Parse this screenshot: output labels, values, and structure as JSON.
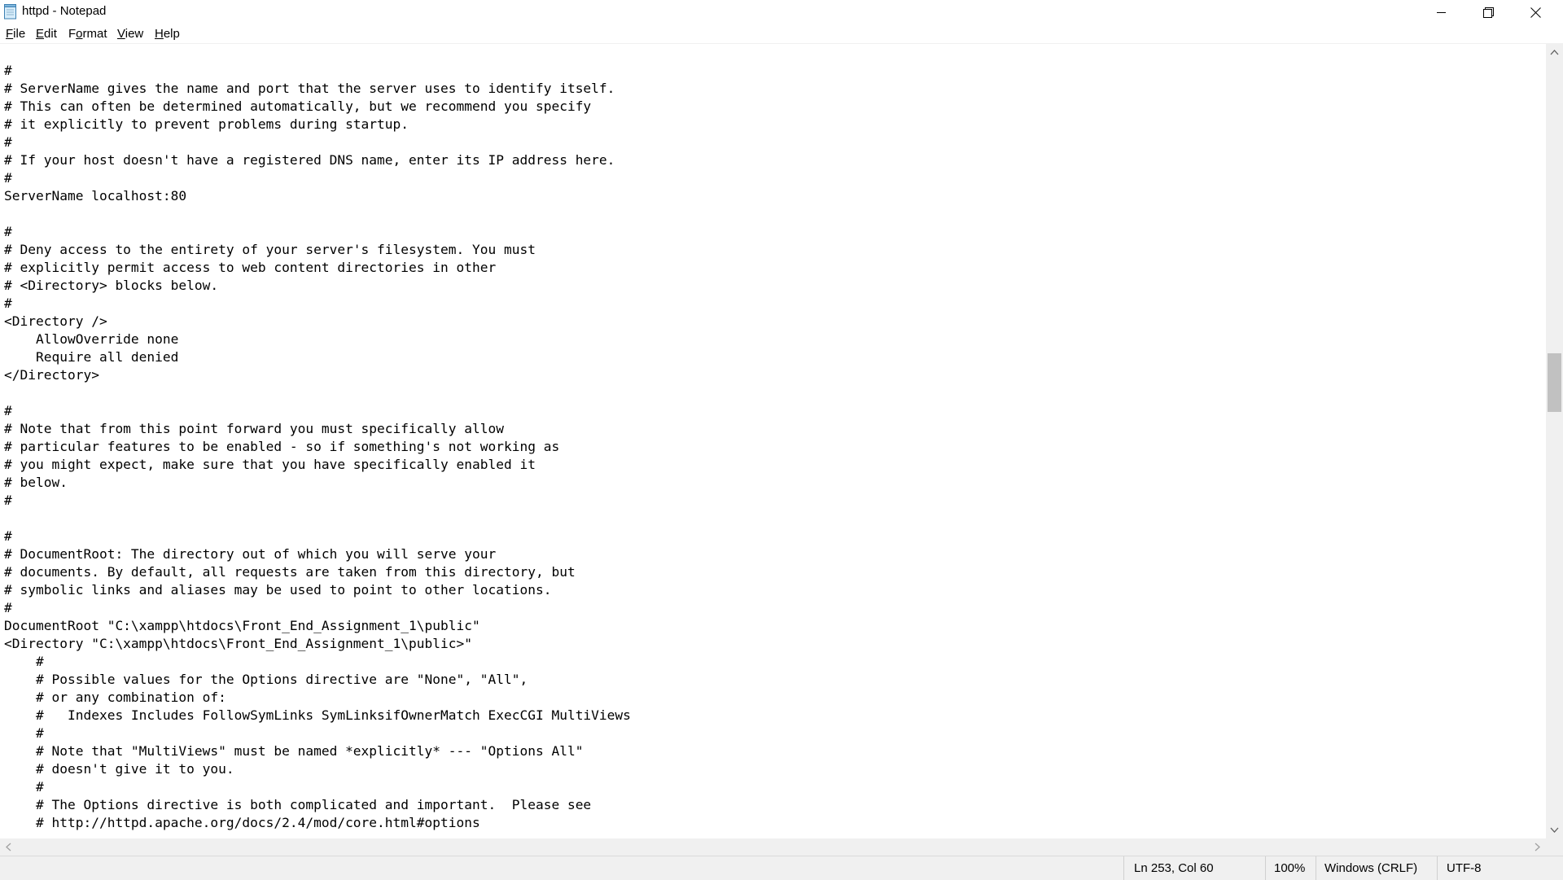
{
  "window": {
    "title": "httpd - Notepad",
    "controls": [
      "minimize",
      "restore",
      "close"
    ]
  },
  "menu": {
    "items": [
      {
        "label": "File",
        "mnemonic": "F",
        "rest": "ile"
      },
      {
        "label": "Edit",
        "mnemonic": "E",
        "rest": "dit"
      },
      {
        "label": "Format",
        "mnemonic": "o",
        "pre": "F",
        "rest": "rmat"
      },
      {
        "label": "View",
        "mnemonic": "V",
        "rest": "iew"
      },
      {
        "label": "Help",
        "mnemonic": "H",
        "rest": "elp"
      }
    ]
  },
  "editor": {
    "lines": [
      "#",
      "# ServerName gives the name and port that the server uses to identify itself.",
      "# This can often be determined automatically, but we recommend you specify",
      "# it explicitly to prevent problems during startup.",
      "#",
      "# If your host doesn't have a registered DNS name, enter its IP address here.",
      "#",
      "ServerName localhost:80",
      "",
      "#",
      "# Deny access to the entirety of your server's filesystem. You must",
      "# explicitly permit access to web content directories in other",
      "# <Directory> blocks below.",
      "#",
      "<Directory />",
      "    AllowOverride none",
      "    Require all denied",
      "</Directory>",
      "",
      "#",
      "# Note that from this point forward you must specifically allow",
      "# particular features to be enabled - so if something's not working as",
      "# you might expect, make sure that you have specifically enabled it",
      "# below.",
      "#",
      "",
      "#",
      "# DocumentRoot: The directory out of which you will serve your",
      "# documents. By default, all requests are taken from this directory, but",
      "# symbolic links and aliases may be used to point to other locations.",
      "#",
      "DocumentRoot \"C:\\xampp\\htdocs\\Front_End_Assignment_1\\public\"",
      "<Directory \"C:\\xampp\\htdocs\\Front_End_Assignment_1\\public>\"",
      "    #",
      "    # Possible values for the Options directive are \"None\", \"All\",",
      "    # or any combination of:",
      "    #   Indexes Includes FollowSymLinks SymLinksifOwnerMatch ExecCGI MultiViews",
      "    #",
      "    # Note that \"MultiViews\" must be named *explicitly* --- \"Options All\"",
      "    # doesn't give it to you.",
      "    #",
      "    # The Options directive is both complicated and important.  Please see",
      "    # http://httpd.apache.org/docs/2.4/mod/core.html#options"
    ]
  },
  "status": {
    "position": "Ln 253, Col 60",
    "zoom": "100%",
    "line_ending": "Windows (CRLF)",
    "encoding": "UTF-8"
  },
  "colors": {
    "background": "#ffffff",
    "chrome": "#f0f0f0",
    "scroll_thumb": "#c1c1c1",
    "text": "#000000"
  }
}
